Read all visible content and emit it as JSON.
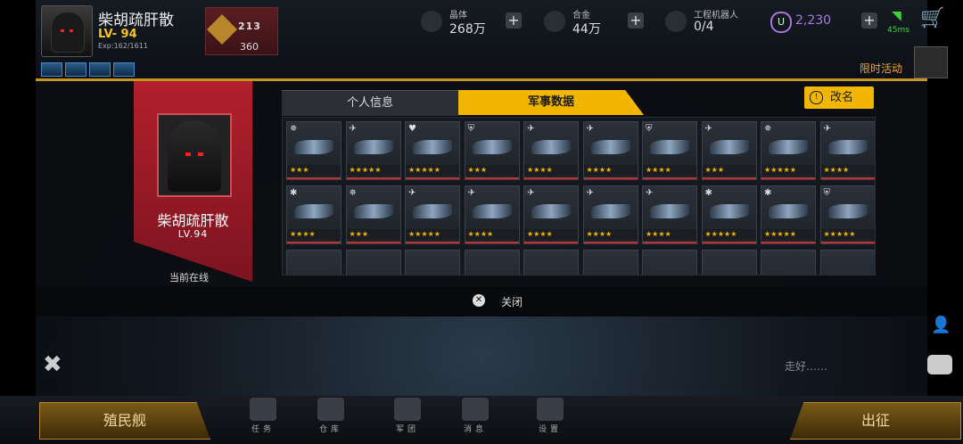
{
  "player": {
    "name": "柴胡疏肝散",
    "level_top": "LV- 94",
    "exp": "Exp:162/1611",
    "rank_podium": "213",
    "rank_value": "360"
  },
  "resources": {
    "crystal_label": "晶体",
    "crystal_value": "268万",
    "alloy_label": "合金",
    "alloy_value": "44万",
    "robot_label": "工程机器人",
    "robot_value": "0/4",
    "u_symbol": "U",
    "u_value": "2,230",
    "ping": "45ms"
  },
  "event_label": "限时活动",
  "profile": {
    "banner_name": "柴胡疏肝散",
    "banner_level": "LV.94",
    "online_status": "当前在线",
    "tab_personal": "个人信息",
    "tab_military": "军事数据",
    "rename_icon": "!",
    "rename_label": "改名"
  },
  "ships": [
    {
      "type": "✵",
      "stars": "★★★"
    },
    {
      "type": "✈",
      "stars": "★★★★★"
    },
    {
      "type": "♥",
      "stars": "★★★★★"
    },
    {
      "type": "⛨",
      "stars": "★★★"
    },
    {
      "type": "✈",
      "stars": "★★★★"
    },
    {
      "type": "✈",
      "stars": "★★★★"
    },
    {
      "type": "⛨",
      "stars": "★★★★"
    },
    {
      "type": "✈",
      "stars": "★★★"
    },
    {
      "type": "✵",
      "stars": "★★★★★"
    },
    {
      "type": "✈",
      "stars": "★★★★"
    },
    {
      "type": "✱",
      "stars": "★★★★"
    },
    {
      "type": "✵",
      "stars": "★★★"
    },
    {
      "type": "✈",
      "stars": "★★★★★"
    },
    {
      "type": "✈",
      "stars": "★★★★"
    },
    {
      "type": "✈",
      "stars": "★★★★"
    },
    {
      "type": "✈",
      "stars": "★★★★"
    },
    {
      "type": "✈",
      "stars": "★★★★"
    },
    {
      "type": "✱",
      "stars": "★★★★★"
    },
    {
      "type": "✱",
      "stars": "★★★★★"
    },
    {
      "type": "⛨",
      "stars": "★★★★★"
    }
  ],
  "close_label": "关闭",
  "greeting": "走好……",
  "bottom": {
    "colony": "殖民舰",
    "attack": "出征",
    "nav": [
      "任务",
      "仓库",
      "军团",
      "消息",
      "设置"
    ]
  },
  "icons": {
    "wifi": "wifi-icon",
    "cart": "cart-icon",
    "wrench": "wrench-icon",
    "chat": "chat-icon"
  }
}
